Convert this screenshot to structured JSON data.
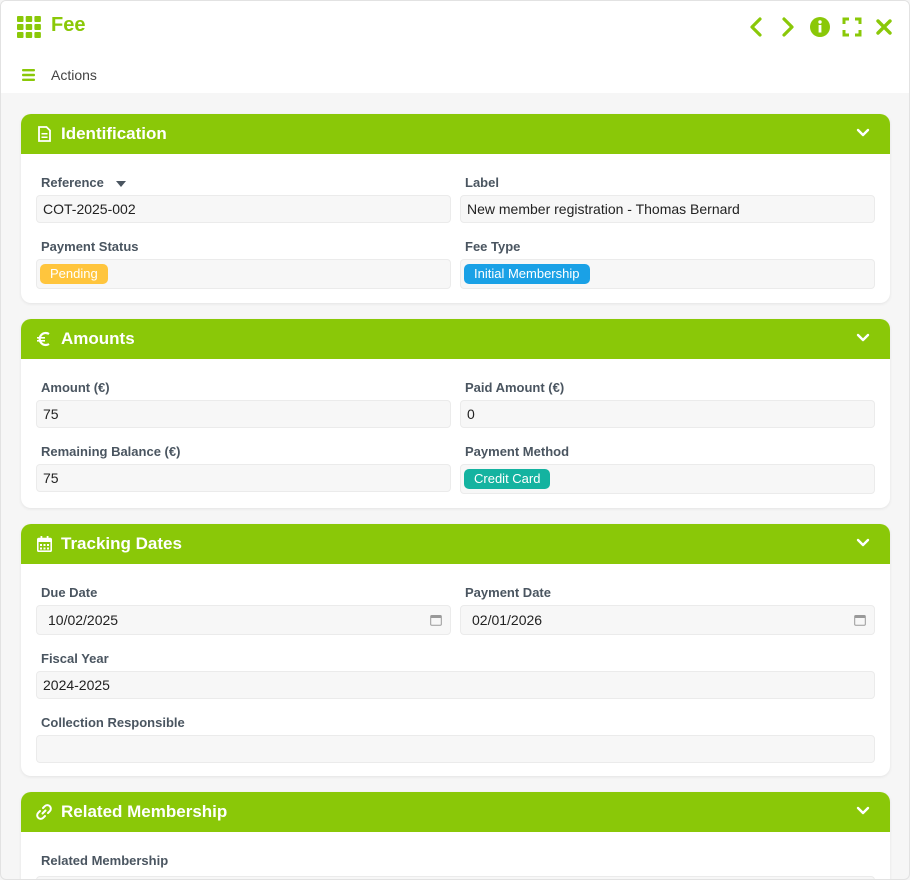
{
  "window": {
    "title": "Fee"
  },
  "toolbar": {
    "actions_label": "Actions"
  },
  "colors": {
    "accent": "#8ac808",
    "pending": "#ffc53d",
    "membership": "#1aa1e6",
    "credit": "#14b3a0"
  },
  "sections": {
    "identification": {
      "title": "Identification",
      "reference_label": "Reference",
      "reference_value": "COT-2025-002",
      "label_label": "Label",
      "label_value": "New member registration - Thomas Bernard",
      "payment_status_label": "Payment Status",
      "payment_status_value": "Pending",
      "fee_type_label": "Fee Type",
      "fee_type_value": "Initial Membership"
    },
    "amounts": {
      "title": "Amounts",
      "amount_label": "Amount (€)",
      "amount_value": "75",
      "paid_amount_label": "Paid Amount (€)",
      "paid_amount_value": "0",
      "remaining_label": "Remaining Balance (€)",
      "remaining_value": "75",
      "payment_method_label": "Payment Method",
      "payment_method_value": "Credit Card"
    },
    "tracking": {
      "title": "Tracking Dates",
      "due_date_label": "Due Date",
      "due_date_value": "10/02/2025",
      "payment_date_label": "Payment Date",
      "payment_date_value": "02/01/2026",
      "fiscal_year_label": "Fiscal Year",
      "fiscal_year_value": "2024-2025",
      "collection_label": "Collection Responsible",
      "collection_value": ""
    },
    "related": {
      "title": "Related Membership",
      "membership_label": "Related Membership"
    }
  }
}
